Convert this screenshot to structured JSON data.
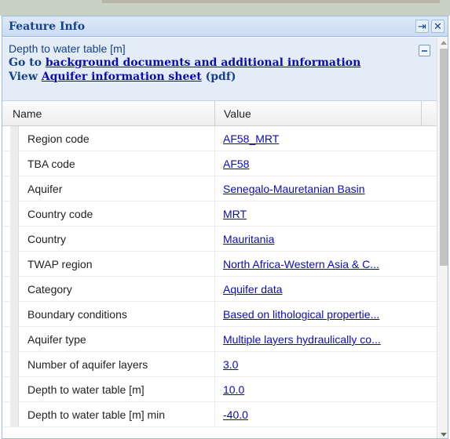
{
  "panel": {
    "title": "Feature Info",
    "tools": {
      "pin": "pin-icon",
      "close": "close-icon"
    }
  },
  "info": {
    "layer_name": "Depth to water table [m]",
    "line1_prefix": "Go to ",
    "line1_link": "background documents and additional information",
    "line2_prefix": "View ",
    "line2_link": "Aquifer information sheet",
    "line2_suffix": " (pdf)"
  },
  "grid": {
    "columns": [
      "Name",
      "Value"
    ],
    "rows": [
      {
        "name": "Region code",
        "value": "AF58_MRT"
      },
      {
        "name": "TBA code",
        "value": "AF58"
      },
      {
        "name": "Aquifer",
        "value": "Senegalo-Mauretanian Basin"
      },
      {
        "name": "Country code",
        "value": "MRT"
      },
      {
        "name": "Country",
        "value": "Mauritania"
      },
      {
        "name": "TWAP region",
        "value": "North Africa-Western Asia & C..."
      },
      {
        "name": "Category",
        "value": "Aquifer data"
      },
      {
        "name": "Boundary conditions",
        "value": "Based on lithological propertie..."
      },
      {
        "name": "Aquifer type",
        "value": "Multiple layers hydraulically co..."
      },
      {
        "name": "Number of aquifer layers",
        "value": "3.0"
      },
      {
        "name": "Depth to water table [m]",
        "value": "10.0"
      },
      {
        "name": "Depth to water table [m] min",
        "value": "-40.0"
      }
    ]
  },
  "colors": {
    "header_text": "#15428b",
    "link": "#0b0bb4",
    "border": "#99bbe8"
  }
}
